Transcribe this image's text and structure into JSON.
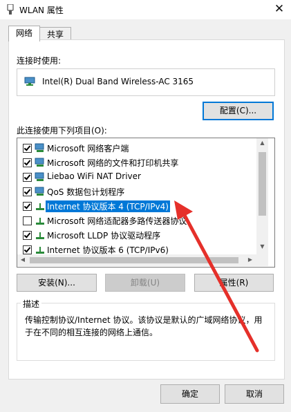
{
  "window": {
    "title": "WLAN 属性",
    "close_label": "✕"
  },
  "tabs": [
    {
      "label": "网络"
    },
    {
      "label": "共享"
    }
  ],
  "connect_using": {
    "label": "连接时使用:",
    "adapter": "Intel(R) Dual Band Wireless-AC 3165",
    "configure_button": "配置(C)..."
  },
  "items_label": "此连接使用下列项目(O):",
  "items": [
    {
      "label": "Microsoft 网络客户端",
      "checked": true,
      "icon": "network-client-icon"
    },
    {
      "label": "Microsoft 网络的文件和打印机共享",
      "checked": true,
      "icon": "network-service-icon"
    },
    {
      "label": "Liebao WiFi NAT Driver",
      "checked": true,
      "icon": "network-service-icon"
    },
    {
      "label": "QoS 数据包计划程序",
      "checked": true,
      "icon": "network-service-icon"
    },
    {
      "label": "Internet 协议版本 4 (TCP/IPv4)",
      "checked": true,
      "selected": true,
      "icon": "protocol-icon"
    },
    {
      "label": "Microsoft 网络适配器多路传送器协议",
      "checked": false,
      "icon": "protocol-icon"
    },
    {
      "label": "Microsoft LLDP 协议驱动程序",
      "checked": true,
      "icon": "protocol-icon"
    },
    {
      "label": "Internet 协议版本 6 (TCP/IPv6)",
      "checked": true,
      "icon": "protocol-icon"
    }
  ],
  "buttons": {
    "install": "安装(N)...",
    "uninstall": "卸载(U)",
    "properties": "属性(R)"
  },
  "description": {
    "title": "描述",
    "text": "传输控制协议/Internet 协议。该协议是默认的广域网络协议，用于在不同的相互连接的网络上通信。"
  },
  "footer": {
    "ok": "确定",
    "cancel": "取消"
  },
  "colors": {
    "selection": "#0078d7",
    "annotation_arrow": "#e5302a"
  }
}
